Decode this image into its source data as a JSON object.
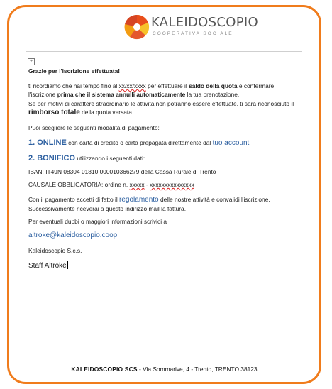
{
  "logo": {
    "name": "KALEIDOSCOPIO",
    "subtitle": "COOPERATIVA SOCIALE"
  },
  "email": {
    "greeting": "Grazie per l'iscrizione effettuata!",
    "p1_a": "ti ricordiamo che hai tempo fino al ",
    "p1_date": "xx/xx/xxxx",
    "p1_b": " per effettuare il ",
    "p1_bold1": "saldo della quota",
    "p1_c": " e confermare l'iscrizione ",
    "p1_bold2": "prima che il sistema annulli automaticamente",
    "p1_d": " la tua prenotazione.",
    "p2_a": "Se per motivi di carattere straordinario le attività non potranno essere effettuate, ti sarà riconosciuto il ",
    "p2_bold": "rimborso totale",
    "p2_b": " della quota versata.",
    "choose": "Puoi scegliere le seguenti modalità di pagamento:",
    "opt1_title": "1. ONLINE",
    "opt1_text": " con carta di credito o carta prepagata direttamente dal ",
    "opt1_link": "tuo account",
    "opt2_title": "2. BONIFICO",
    "opt2_text": " utilizzando i seguenti dati:",
    "iban": "IBAN: IT49N 08304 01810 000010366279 della Cassa Rurale di Trento",
    "causale_a": "CAUSALE OBBLIGATORIA: ordine n. ",
    "causale_x1": "xxxxx",
    "causale_sep": " - ",
    "causale_x2": "xxxxxxxxxxxxxxx",
    "p3_a": "Con il pagamento accetti di fatto il ",
    "p3_link": "regolamento",
    "p3_b": " delle nostre attività e convalidi l'iscrizione. Successivamente riceverai a questo indirizzo mail la fattura.",
    "p4": "Per eventuali dubbi o maggiori informazioni scrivici a",
    "contact_email": "altroke@kaleidoscopio.coop",
    "contact_suffix": ".",
    "company": "Kaleidoscopio S.c.s.",
    "signature": "Staff Altroke"
  },
  "footer": {
    "company": "KALEIDOSCOPIO SCS",
    "address": " -  Via Sommarive, 4 -  Trento,  TRENTO  38123"
  }
}
